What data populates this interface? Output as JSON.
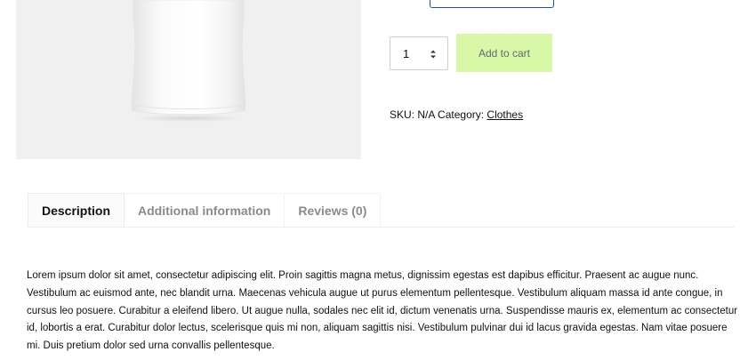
{
  "quantity": {
    "value": "1"
  },
  "add_to_cart": {
    "label": "Add to cart"
  },
  "meta": {
    "sku_label": "SKU:",
    "sku_value": "N/A",
    "category_label": "Category:",
    "category_value": "Clothes"
  },
  "tabs": [
    {
      "label": "Description",
      "active": true
    },
    {
      "label": "Additional information",
      "active": false
    },
    {
      "label": "Reviews (0)",
      "active": false
    }
  ],
  "description": {
    "text": "Lorem ipsum dolor sit amet, consectetur adipiscing elit. Proin sagittis magna metus, dignissim egestas est dapibus efficitur. Praesent ac augue nunc. Vestibulum ac euismod ante, nec blandit urna. Maecenas vehicula augue ut purus elementum pellentesque. Vestibulum aliquam massa id ante congue, in cursus leo posuere. Curabitur a eleifend libero. Ut augue nulla, sodales nec elit id, dictum venenatis urna. Suspendisse mauris ex, elementum ac consectetur id, lobortis a erat. Curabitur dolor lectus, scelerisque quis mi non, aliquam sagittis nisi. Vestibulum pulvinar dui id lacus gravida egestas. Nam vitae posuere mi. Duis pretium dolor sed urna convallis pellentesque."
  },
  "colors": {
    "image_bg": "#f0f0f0",
    "add_to_cart_bg": "#d8f8a8",
    "select_border": "#1e4fb5",
    "inactive_tab": "#8a8a8a"
  },
  "icons": {
    "qty_spinner": "spinner-arrows-icon"
  }
}
